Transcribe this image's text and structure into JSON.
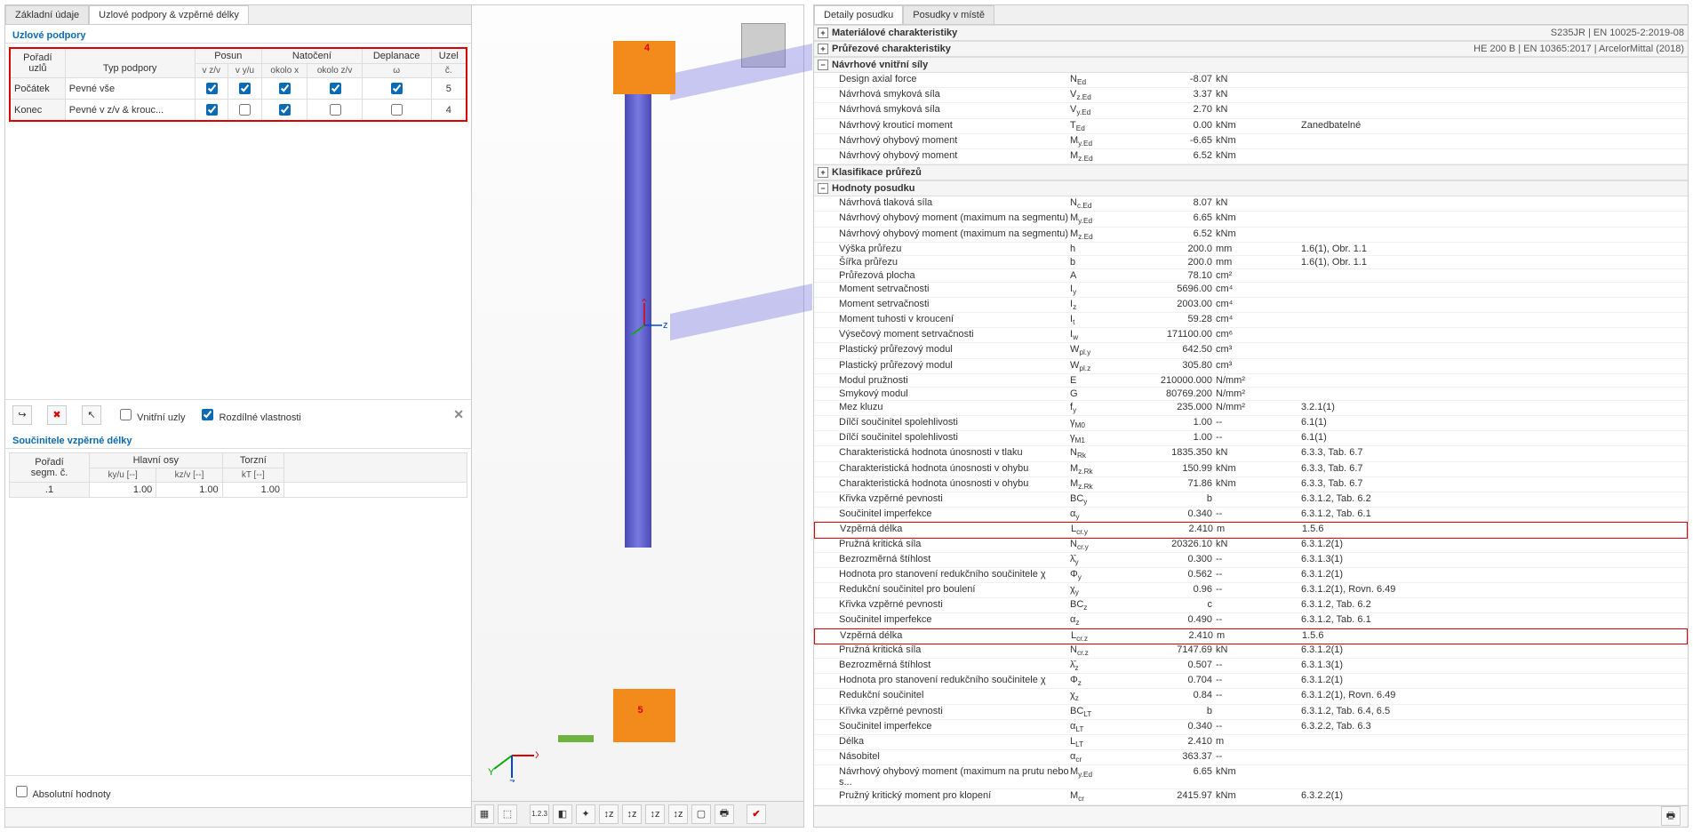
{
  "left": {
    "tabs": [
      "Základní údaje",
      "Uzlové podpory & vzpěrné délky"
    ],
    "activeTab": 1,
    "group1": "Uzlové podpory",
    "headers": {
      "col1a": "Pořadí",
      "col1b": "uzlů",
      "col2": "Typ podpory",
      "posun": "Posun",
      "posun_a": "v z/v",
      "posun_b": "v y/u",
      "natoceni": "Natočení",
      "nat_a": "okolo x",
      "nat_b": "okolo z/v",
      "deplanace": "Deplanace",
      "dep_a": "ω",
      "uzel": "Uzel",
      "uzel_b": "č."
    },
    "rows": [
      {
        "poradi": "Počátek",
        "typ": "Pevné vše",
        "checks": [
          true,
          true,
          true,
          true,
          true
        ],
        "uzel": "5"
      },
      {
        "poradi": "Konec",
        "typ": "Pevné v z/v & krouc...",
        "checks": [
          true,
          false,
          true,
          false,
          false
        ],
        "uzel": "4"
      }
    ],
    "vnitrni": "Vnitřní uzly",
    "rozdilne": "Rozdílné vlastnosti",
    "group2": "Součinitele vzpěrné délky",
    "seg_head": {
      "a": "Pořadí",
      "b": "segm. č.",
      "main": "Hlavní osy",
      "torzni": "Torzní",
      "ky": "ky/u [--]",
      "kz": "kz/v [--]",
      "kt": "kT [--]"
    },
    "seg_rows": [
      {
        "n": ".1",
        "ky": "1.00",
        "kz": "1.00",
        "kt": "1.00"
      }
    ],
    "abs": "Absolutní hodnoty"
  },
  "right": {
    "tabs": [
      "Detaily posudku",
      "Posudky v místě"
    ],
    "activeTab": 0,
    "sections": {
      "s1": "Materiálové charakteristiky",
      "s1_meta": "S235JR | EN 10025-2:2019-08",
      "s2": "Průřezové charakteristiky",
      "s2_meta": "HE 200 B | EN 10365:2017 | ArcelorMittal (2018)",
      "s3": "Návrhové vnitřní síly",
      "s4": "Klasifikace průřezů",
      "s5": "Hodnoty posudku"
    },
    "nvs": [
      {
        "name": "Design axial force",
        "sym": "N_Ed",
        "val": "-8.07",
        "unit": "kN",
        "ref": ""
      },
      {
        "name": "Návrhová smyková síla",
        "sym": "V_z.Ed",
        "val": "3.37",
        "unit": "kN",
        "ref": ""
      },
      {
        "name": "Návrhová smyková síla",
        "sym": "V_y.Ed",
        "val": "2.70",
        "unit": "kN",
        "ref": ""
      },
      {
        "name": "Návrhový krouticí moment",
        "sym": "T_Ed",
        "val": "0.00",
        "unit": "kNm",
        "ref": "Zanedbatelné"
      },
      {
        "name": "Návrhový ohybový moment",
        "sym": "M_y.Ed",
        "val": "-6.65",
        "unit": "kNm",
        "ref": ""
      },
      {
        "name": "Návrhový ohybový moment",
        "sym": "M_z.Ed",
        "val": "6.52",
        "unit": "kNm",
        "ref": ""
      }
    ],
    "hodnoty": [
      {
        "name": "Návrhová tlaková síla",
        "sym": "N_c.Ed",
        "val": "8.07",
        "unit": "kN",
        "ref": ""
      },
      {
        "name": "Návrhový ohybový moment (maximum na segmentu)",
        "sym": "M_y.Ed",
        "val": "6.65",
        "unit": "kNm",
        "ref": ""
      },
      {
        "name": "Návrhový ohybový moment (maximum na segmentu)",
        "sym": "M_z.Ed",
        "val": "6.52",
        "unit": "kNm",
        "ref": ""
      },
      {
        "name": "Výška průřezu",
        "sym": "h",
        "val": "200.0",
        "unit": "mm",
        "ref": "1.6(1), Obr. 1.1"
      },
      {
        "name": "Šířka průřezu",
        "sym": "b",
        "val": "200.0",
        "unit": "mm",
        "ref": "1.6(1), Obr. 1.1"
      },
      {
        "name": "Průřezová plocha",
        "sym": "A",
        "val": "78.10",
        "unit": "cm²",
        "ref": ""
      },
      {
        "name": "Moment setrvačnosti",
        "sym": "I_y",
        "val": "5696.00",
        "unit": "cm⁴",
        "ref": ""
      },
      {
        "name": "Moment setrvačnosti",
        "sym": "I_z",
        "val": "2003.00",
        "unit": "cm⁴",
        "ref": ""
      },
      {
        "name": "Moment tuhosti v kroucení",
        "sym": "I_t",
        "val": "59.28",
        "unit": "cm⁴",
        "ref": ""
      },
      {
        "name": "Výsečový moment setrvačnosti",
        "sym": "I_w",
        "val": "171100.00",
        "unit": "cm⁶",
        "ref": ""
      },
      {
        "name": "Plastický průřezový modul",
        "sym": "W_pl.y",
        "val": "642.50",
        "unit": "cm³",
        "ref": ""
      },
      {
        "name": "Plastický průřezový modul",
        "sym": "W_pl.z",
        "val": "305.80",
        "unit": "cm³",
        "ref": ""
      },
      {
        "name": "Modul pružnosti",
        "sym": "E",
        "val": "210000.000",
        "unit": "N/mm²",
        "ref": ""
      },
      {
        "name": "Smykový modul",
        "sym": "G",
        "val": "80769.200",
        "unit": "N/mm²",
        "ref": ""
      },
      {
        "name": "Mez kluzu",
        "sym": "f_y",
        "val": "235.000",
        "unit": "N/mm²",
        "ref": "3.2.1(1)"
      },
      {
        "name": "Dílčí součinitel spolehlivosti",
        "sym": "γ_M0",
        "val": "1.00",
        "unit": "--",
        "ref": "6.1(1)"
      },
      {
        "name": "Dílčí součinitel spolehlivosti",
        "sym": "γ_M1",
        "val": "1.00",
        "unit": "--",
        "ref": "6.1(1)"
      },
      {
        "name": "Charakteristická hodnota únosnosti v tlaku",
        "sym": "N_Rk",
        "val": "1835.350",
        "unit": "kN",
        "ref": "6.3.3, Tab. 6.7"
      },
      {
        "name": "Charakteristická hodnota únosnosti v ohybu",
        "sym": "M_z.Rk",
        "val": "150.99",
        "unit": "kNm",
        "ref": "6.3.3, Tab. 6.7"
      },
      {
        "name": "Charakteristická hodnota únosnosti v ohybu",
        "sym": "M_z.Rk",
        "val": "71.86",
        "unit": "kNm",
        "ref": "6.3.3, Tab. 6.7"
      },
      {
        "name": "Křivka vzpěrné pevnosti",
        "sym": "BC_y",
        "val": "b",
        "unit": "",
        "ref": "6.3.1.2, Tab. 6.2"
      },
      {
        "name": "Součinitel imperfekce",
        "sym": "α_y",
        "val": "0.340",
        "unit": "--",
        "ref": "6.3.1.2, Tab. 6.1"
      },
      {
        "name": "Vzpěrná délka",
        "sym": "L_cr.y",
        "val": "2.410",
        "unit": "m",
        "ref": "1.5.6",
        "hl": true
      },
      {
        "name": "Pružná kritická síla",
        "sym": "N_cr.y",
        "val": "20326.10",
        "unit": "kN",
        "ref": "6.3.1.2(1)"
      },
      {
        "name": "Bezrozměrná štíhlost",
        "sym": "λ̄_y",
        "val": "0.300",
        "unit": "--",
        "ref": "6.3.1.3(1)"
      },
      {
        "name": "Hodnota pro stanovení redukčního součinitele χ",
        "sym": "Φ_y",
        "val": "0.562",
        "unit": "--",
        "ref": "6.3.1.2(1)"
      },
      {
        "name": "Redukční součinitel pro boulení",
        "sym": "χ_y",
        "val": "0.96",
        "unit": "--",
        "ref": "6.3.1.2(1), Rovn. 6.49"
      },
      {
        "name": "Křivka vzpěrné pevnosti",
        "sym": "BC_z",
        "val": "c",
        "unit": "",
        "ref": "6.3.1.2, Tab. 6.2"
      },
      {
        "name": "Součinitel imperfekce",
        "sym": "α_z",
        "val": "0.490",
        "unit": "--",
        "ref": "6.3.1.2, Tab. 6.1"
      },
      {
        "name": "Vzpěrná délka",
        "sym": "L_cr.z",
        "val": "2.410",
        "unit": "m",
        "ref": "1.5.6",
        "hl": true
      },
      {
        "name": "Pružná kritická síla",
        "sym": "N_cr.z",
        "val": "7147.69",
        "unit": "kN",
        "ref": "6.3.1.2(1)"
      },
      {
        "name": "Bezrozměrná štíhlost",
        "sym": "λ̄_z",
        "val": "0.507",
        "unit": "--",
        "ref": "6.3.1.3(1)"
      },
      {
        "name": "Hodnota pro stanovení redukčního součinitele χ",
        "sym": "Φ_z",
        "val": "0.704",
        "unit": "--",
        "ref": "6.3.1.2(1)"
      },
      {
        "name": "Redukční součinitel",
        "sym": "χ_z",
        "val": "0.84",
        "unit": "--",
        "ref": "6.3.1.2(1), Rovn. 6.49"
      },
      {
        "name": "Křivka vzpěrné pevnosti",
        "sym": "BC_LT",
        "val": "b",
        "unit": "",
        "ref": "6.3.1.2, Tab. 6.4, 6.5"
      },
      {
        "name": "Součinitel imperfekce",
        "sym": "α_LT",
        "val": "0.340",
        "unit": "--",
        "ref": "6.3.2.2, Tab. 6.3"
      },
      {
        "name": "Délka",
        "sym": "L_LT",
        "val": "2.410",
        "unit": "m",
        "ref": ""
      },
      {
        "name": "Násobitel",
        "sym": "α_cr",
        "val": "363.37",
        "unit": "--",
        "ref": ""
      },
      {
        "name": "Návrhový ohybový moment (maximum na prutu nebo s...",
        "sym": "M_y.Ed",
        "val": "6.65",
        "unit": "kNm",
        "ref": ""
      },
      {
        "name": "Pružný kritický moment pro klopení",
        "sym": "M_cr",
        "val": "2415.97",
        "unit": "kNm",
        "ref": "6.3.2.2(1)"
      }
    ]
  }
}
